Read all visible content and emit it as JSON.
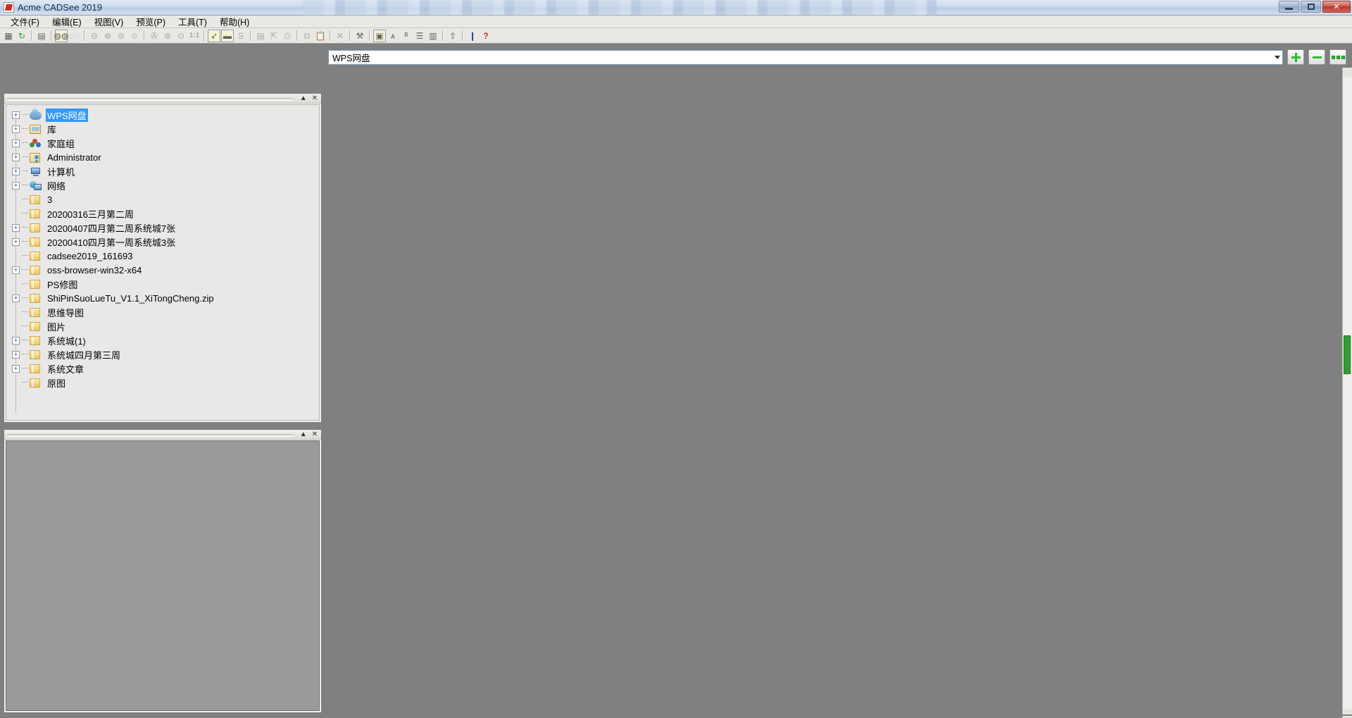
{
  "window": {
    "title": "Acme CADSee 2019",
    "app_icon": "app-logo-icon",
    "buttons": {
      "minimize": "–",
      "maximize": "❐",
      "close": "✕"
    }
  },
  "menubar": {
    "items": [
      {
        "label": "文件(F)",
        "name": "menu-file"
      },
      {
        "label": "编辑(E)",
        "name": "menu-edit"
      },
      {
        "label": "视图(V)",
        "name": "menu-view"
      },
      {
        "label": "预览(P)",
        "name": "menu-preview"
      },
      {
        "label": "工具(T)",
        "name": "menu-tools"
      },
      {
        "label": "帮助(H)",
        "name": "menu-help"
      }
    ]
  },
  "toolbar": {
    "items": [
      {
        "name": "thumbnail-grid-icon",
        "glyph": "▦",
        "state": "normal"
      },
      {
        "name": "refresh-icon",
        "glyph": "↻",
        "state": "green"
      },
      {
        "sep": true
      },
      {
        "name": "layout-split-icon",
        "glyph": "▤",
        "state": "normal"
      },
      {
        "sep": true
      },
      {
        "name": "view-pair-icon",
        "glyph": "◍◍",
        "state": "active"
      },
      {
        "name": "view-pair-alt-icon",
        "glyph": "◌◌",
        "state": "disabled"
      },
      {
        "sep": true
      },
      {
        "name": "zoom-out-icon",
        "glyph": "⊖",
        "state": "disabled"
      },
      {
        "name": "zoom-in-icon",
        "glyph": "⊕",
        "state": "disabled"
      },
      {
        "name": "zoom-fit-icon",
        "glyph": "⊜",
        "state": "disabled"
      },
      {
        "name": "zoom-region-icon",
        "glyph": "⟐",
        "state": "disabled"
      },
      {
        "sep": true
      },
      {
        "name": "pan-icon",
        "glyph": "✇",
        "state": "disabled"
      },
      {
        "name": "zoom-all-icon",
        "glyph": "⊛",
        "state": "disabled"
      },
      {
        "name": "zoom-window-icon",
        "glyph": "⊙",
        "state": "disabled"
      },
      {
        "name": "zoom-actual-size-icon",
        "glyph": "1:1",
        "state": "disabled"
      },
      {
        "sep": true
      },
      {
        "name": "measure-icon",
        "glyph": "➶",
        "state": "active"
      },
      {
        "name": "ruler-icon",
        "glyph": "▬",
        "state": "active"
      },
      {
        "name": "snap-icon",
        "glyph": "S",
        "state": "disabled"
      },
      {
        "sep": true
      },
      {
        "name": "print-preview-icon",
        "glyph": "▤",
        "state": "disabled"
      },
      {
        "name": "page-setup-icon",
        "glyph": "⇱",
        "state": "disabled"
      },
      {
        "name": "print-icon",
        "glyph": "⎙",
        "state": "disabled"
      },
      {
        "sep": true
      },
      {
        "name": "copy-icon",
        "glyph": "⧉",
        "state": "disabled"
      },
      {
        "name": "paste-icon",
        "glyph": "📋",
        "state": "disabled"
      },
      {
        "sep": true
      },
      {
        "name": "delete-icon",
        "glyph": "✕",
        "state": "disabled"
      },
      {
        "sep": true
      },
      {
        "name": "batch-convert-icon",
        "glyph": "⚒",
        "state": "normal"
      },
      {
        "sep": true
      },
      {
        "name": "color-settings-icon",
        "glyph": "▣",
        "state": "active"
      },
      {
        "name": "layer-a-icon",
        "glyph": "ᴀ",
        "state": "normal"
      },
      {
        "name": "layer-b-icon",
        "glyph": "ᴮ",
        "state": "normal"
      },
      {
        "name": "layer-list-icon",
        "glyph": "☰",
        "state": "normal"
      },
      {
        "name": "properties-icon",
        "glyph": "▥",
        "state": "normal"
      },
      {
        "sep": true
      },
      {
        "name": "export-icon",
        "glyph": "⇪",
        "state": "normal"
      },
      {
        "sep": true
      },
      {
        "name": "info-icon",
        "glyph": "❙",
        "state": "blue"
      },
      {
        "name": "help-icon",
        "glyph": "?",
        "state": "help"
      }
    ]
  },
  "sidebar": {
    "tree_panel": {
      "name": "folder-tree-panel",
      "collapse_label": "▲",
      "close_label": "✕",
      "nodes": [
        {
          "label": "WPS网盘",
          "icon": "cloud-icon",
          "expandable": true,
          "selected": true,
          "indent": 0
        },
        {
          "label": "库",
          "icon": "library-icon",
          "expandable": true,
          "selected": false,
          "indent": 0
        },
        {
          "label": "家庭组",
          "icon": "homegroup-icon",
          "expandable": true,
          "selected": false,
          "indent": 0
        },
        {
          "label": "Administrator",
          "icon": "user-folder-icon",
          "expandable": true,
          "selected": false,
          "indent": 0
        },
        {
          "label": "计算机",
          "icon": "computer-icon",
          "expandable": true,
          "selected": false,
          "indent": 0
        },
        {
          "label": "网络",
          "icon": "network-icon",
          "expandable": true,
          "selected": false,
          "indent": 0
        },
        {
          "label": "3",
          "icon": "folder-icon",
          "expandable": false,
          "selected": false,
          "indent": 0
        },
        {
          "label": "20200316三月第二周",
          "icon": "folder-icon",
          "expandable": false,
          "selected": false,
          "indent": 0
        },
        {
          "label": "20200407四月第二周系统城7张",
          "icon": "folder-icon",
          "expandable": true,
          "selected": false,
          "indent": 0
        },
        {
          "label": "20200410四月第一周系统城3张",
          "icon": "folder-icon",
          "expandable": true,
          "selected": false,
          "indent": 0
        },
        {
          "label": "cadsee2019_161693",
          "icon": "folder-icon",
          "expandable": false,
          "selected": false,
          "indent": 0
        },
        {
          "label": "oss-browser-win32-x64",
          "icon": "folder-icon",
          "expandable": true,
          "selected": false,
          "indent": 0
        },
        {
          "label": "PS修图",
          "icon": "folder-icon",
          "expandable": false,
          "selected": false,
          "indent": 0
        },
        {
          "label": "ShiPinSuoLueTu_V1.1_XiTongCheng.zip",
          "icon": "folder-icon",
          "expandable": true,
          "selected": false,
          "indent": 0
        },
        {
          "label": "思维导图",
          "icon": "folder-icon",
          "expandable": false,
          "selected": false,
          "indent": 0
        },
        {
          "label": "图片",
          "icon": "folder-icon",
          "expandable": false,
          "selected": false,
          "indent": 0
        },
        {
          "label": "系统城(1)",
          "icon": "folder-icon",
          "expandable": true,
          "selected": false,
          "indent": 0
        },
        {
          "label": "系统城四月第三周",
          "icon": "folder-icon",
          "expandable": true,
          "selected": false,
          "indent": 0
        },
        {
          "label": "系统文章",
          "icon": "folder-icon",
          "expandable": true,
          "selected": false,
          "indent": 0
        },
        {
          "label": "原图",
          "icon": "folder-icon",
          "expandable": false,
          "selected": false,
          "indent": 0
        }
      ]
    },
    "preview_panel": {
      "name": "preview-panel",
      "collapse_label": "▲",
      "close_label": "✕"
    }
  },
  "main": {
    "address": {
      "value": "WPS网盘",
      "placeholder": "WPS网盘",
      "dropdown_icon": "chevron-down-icon"
    },
    "buttons": [
      {
        "name": "add-folder-button",
        "icon": "plus-icon"
      },
      {
        "name": "remove-folder-button",
        "icon": "minus-icon"
      },
      {
        "name": "more-options-button",
        "icon": "ellipsis-icon"
      }
    ],
    "content": {
      "empty": true
    }
  },
  "colors": {
    "accent_green": "#2bbd2b",
    "selection_blue": "#3399ff",
    "canvas_gray": "#808080",
    "panel_gray": "#e9e8e6",
    "chrome_gray": "#e9e8e4"
  }
}
